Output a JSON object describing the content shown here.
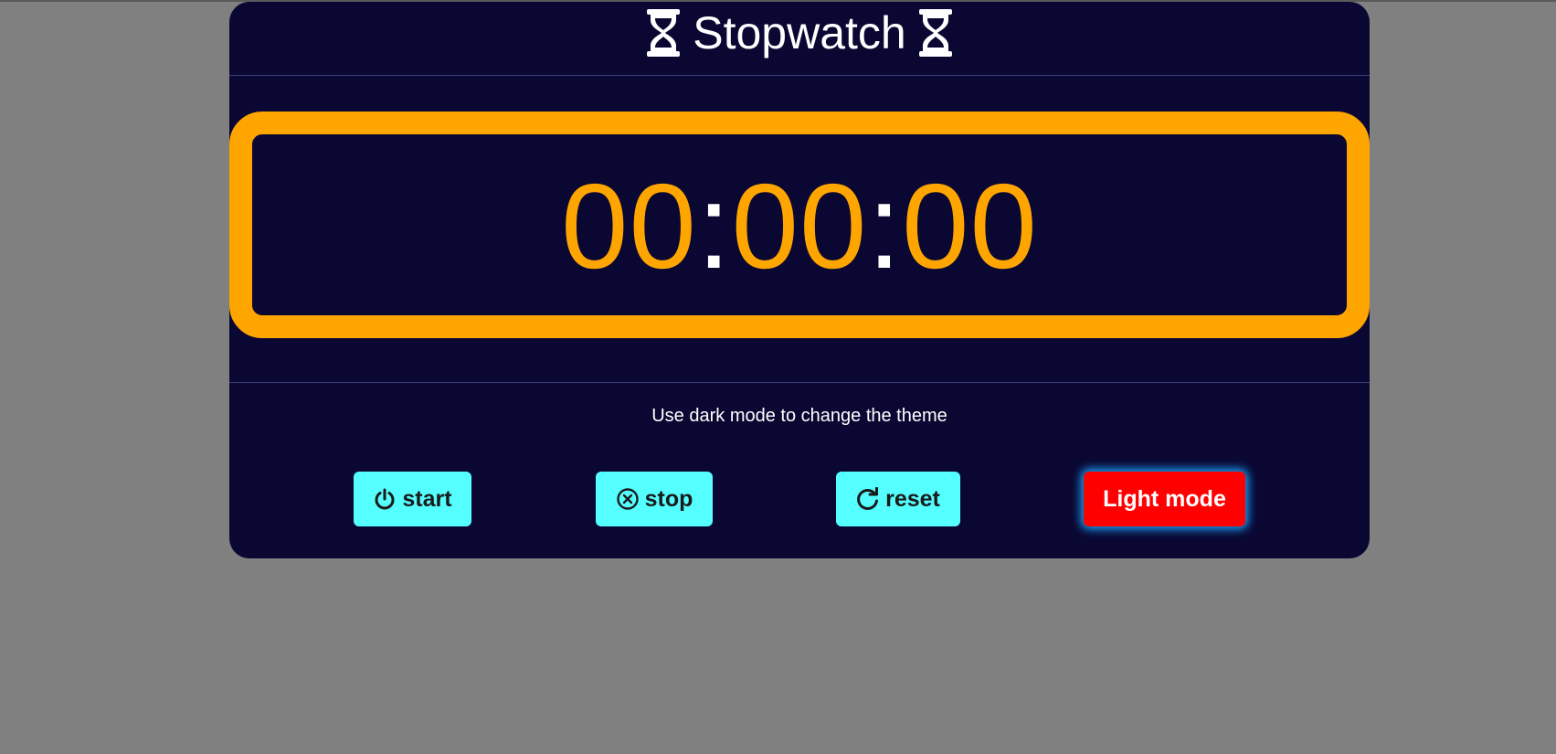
{
  "header": {
    "title": "Stopwatch",
    "left_icon": "hourglass-icon",
    "right_icon": "hourglass-icon"
  },
  "timer": {
    "hours": "00",
    "minutes": "00",
    "seconds": "00",
    "separator": ":"
  },
  "hint": "Use dark mode to change the theme",
  "buttons": {
    "start": {
      "label": "start",
      "icon": "power-icon"
    },
    "stop": {
      "label": "stop",
      "icon": "circle-x-icon"
    },
    "reset": {
      "label": "reset",
      "icon": "redo-icon"
    },
    "theme": {
      "label": "Light mode"
    }
  },
  "colors": {
    "page_background": "#808080",
    "card_background": "#0a0733",
    "accent_orange": "#ffa500",
    "button_cyan": "#55ffff",
    "button_red": "#ff0000",
    "glow_blue": "#1aa7ff"
  }
}
